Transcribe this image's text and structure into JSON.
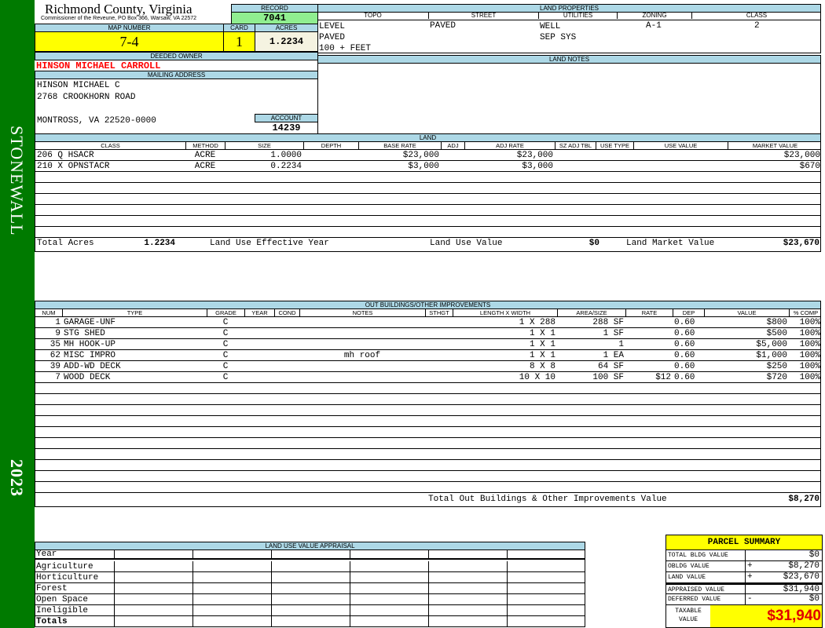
{
  "sidebar": {
    "district": "STONEWALL",
    "year": "2023"
  },
  "header": {
    "title": "Richmond County, Virginia",
    "subtitle": "Commissioner of the Reveune, PO Box 366, Warsaw, VA 22572",
    "record_label": "RECORD",
    "record": "7041",
    "map_label": "MAP NUMBER",
    "map": "7-4",
    "card_label": "CARD",
    "card": "1",
    "acres_label": "ACRES",
    "acres": "1.2234"
  },
  "owner": {
    "deeded_label": "DEEDED OWNER",
    "deeded": "HINSON MICHAEL  CARROLL",
    "mailing_label": "MAILING ADDRESS",
    "line1": "HINSON MICHAEL C",
    "line2": "2768 CROOKHORN ROAD",
    "line3": "MONTROSS, VA 22520-0000",
    "account_label": "ACCOUNT",
    "account": "14239"
  },
  "land_properties": {
    "title": "LAND PROPERTIES",
    "columns": [
      "TOPO",
      "STREET",
      "UTILITIES",
      "ZONING",
      "CLASS"
    ],
    "topo": [
      "LEVEL",
      "PAVED",
      "100 + FEET"
    ],
    "street": "PAVED",
    "utilities": [
      "WELL",
      "SEP SYS"
    ],
    "zoning": "A-1",
    "class": "2"
  },
  "land_notes": {
    "title": "LAND NOTES"
  },
  "land": {
    "title": "LAND",
    "columns": [
      "CLASS",
      "METHOD",
      "SIZE",
      "DEPTH",
      "BASE RATE",
      "ADJ",
      "ADJ RATE",
      "SZ ADJ TBL",
      "USE TYPE",
      "USE VALUE",
      "MARKET VALUE"
    ],
    "rows": [
      [
        "206 Q HSACR",
        "ACRE",
        "1.0000",
        "",
        "$23,000",
        "",
        "$23,000",
        "",
        "",
        "",
        "$23,000"
      ],
      [
        "210 X OPNSTACR",
        "ACRE",
        "0.2234",
        "",
        "$3,000",
        "",
        "$3,000",
        "",
        "",
        "",
        "$670"
      ]
    ],
    "total_acres_label": "Total Acres",
    "total_acres": "1.2234",
    "effective_year_label": "Land Use Effective Year",
    "use_value_label": "Land Use Value",
    "use_value": "$0",
    "market_value_label": "Land Market Value",
    "market_value": "$23,670"
  },
  "outbuildings": {
    "title": "OUT BUILDINGS/OTHER IMPROVEMENTS",
    "columns": [
      "NUM",
      "TYPE",
      "GRADE",
      "YEAR",
      "COND",
      "NOTES",
      "STHGT",
      "LENGTH X WIDTH",
      "AREA/SIZE",
      "RATE",
      "DEP",
      "VALUE",
      "% COMP"
    ],
    "rows": [
      [
        "1",
        "GARAGE-UNF",
        "C",
        "",
        "",
        "",
        "",
        "1 X 288",
        "288 SF",
        "",
        "0.60",
        "$800",
        "100%"
      ],
      [
        "9",
        "STG SHED",
        "C",
        "",
        "",
        "",
        "",
        "1 X 1",
        "1 SF",
        "",
        "0.60",
        "$500",
        "100%"
      ],
      [
        "35",
        "MH HOOK-UP",
        "C",
        "",
        "",
        "",
        "",
        "1 X 1",
        "1",
        "",
        "0.60",
        "$5,000",
        "100%"
      ],
      [
        "62",
        "MISC IMPRO",
        "C",
        "",
        "",
        "mh roof",
        "",
        "1 X 1",
        "1 EA",
        "",
        "0.60",
        "$1,000",
        "100%"
      ],
      [
        "39",
        "ADD-WD DECK",
        "C",
        "",
        "",
        "",
        "",
        "8 X 8",
        "64 SF",
        "",
        "0.60",
        "$250",
        "100%"
      ],
      [
        "7",
        "WOOD DECK",
        "C",
        "",
        "",
        "",
        "",
        "10 X 10",
        "100 SF",
        "$12",
        "0.60",
        "$720",
        "100%"
      ]
    ],
    "total_label": "Total Out Buildings & Other Improvements Value",
    "total": "$8,270"
  },
  "land_use_appraisal": {
    "title": "LAND USE VALUE APPRAISAL",
    "rows": [
      "Year",
      "Agriculture",
      "Horticulture",
      "Forest",
      "Open Space",
      "Ineligible",
      "Totals"
    ]
  },
  "parcel_summary": {
    "title": "PARCEL SUMMARY",
    "rows": [
      {
        "label": "TOTAL BLDG VALUE",
        "sign": "",
        "value": "$0"
      },
      {
        "label": "OBLDG VALUE",
        "sign": "+",
        "value": "$8,270"
      },
      {
        "label": "LAND VALUE",
        "sign": "+",
        "value": "$23,670"
      },
      {
        "label": "APPRAISED VALUE",
        "sign": "",
        "value": "$31,940"
      },
      {
        "label": "DEFERRED VALUE",
        "sign": "-",
        "value": "$0"
      }
    ],
    "taxable_label": "TAXABLE VALUE",
    "taxable": "$31,940"
  },
  "colors": {
    "sidebar": "#007a00",
    "header": "#add8e6",
    "highlight": "#ffff00",
    "record": "#90ee90",
    "owner": "#ff0000"
  }
}
